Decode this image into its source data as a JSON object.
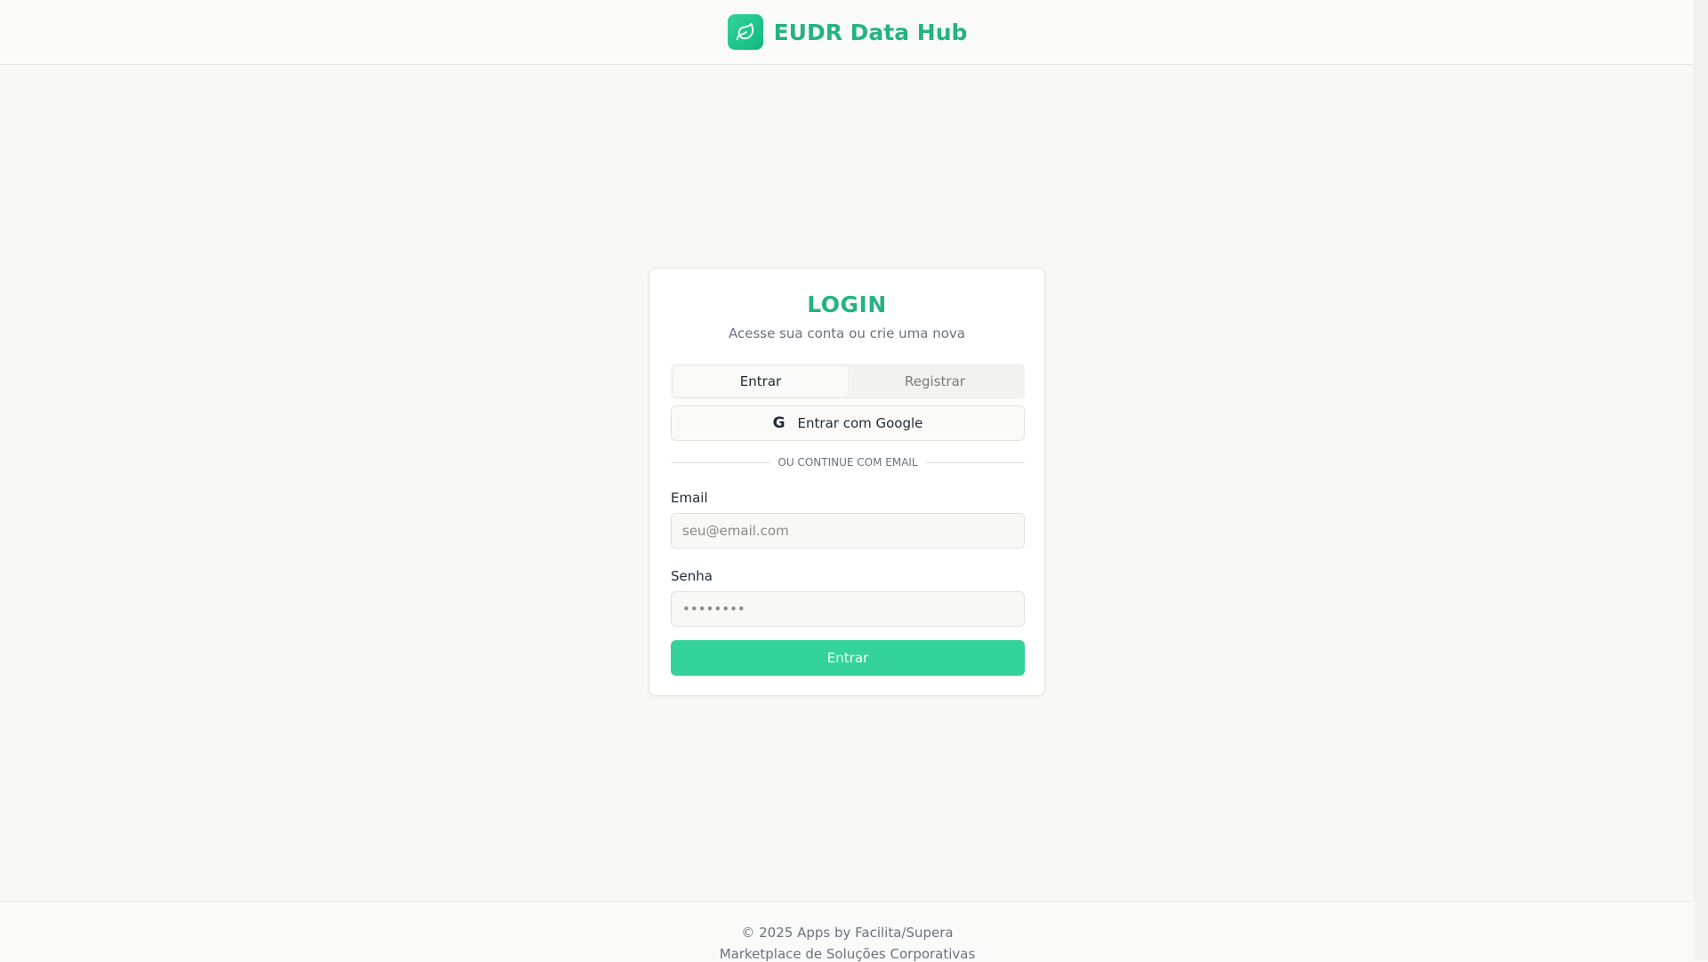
{
  "header": {
    "brand_name": "EUDR Data Hub",
    "logo_icon": "leaf-icon",
    "accent_color": "#24b382"
  },
  "login": {
    "title": "LOGIN",
    "subtitle": "Acesse sua conta ou crie uma nova",
    "tabs": [
      {
        "label": "Entrar",
        "active": true
      },
      {
        "label": "Registrar",
        "active": false
      }
    ],
    "google_button": {
      "label": "Entrar com Google",
      "icon": "google-icon"
    },
    "divider_text": "OU CONTINUE COM EMAIL",
    "email": {
      "label": "Email",
      "placeholder": "seu@email.com",
      "value": ""
    },
    "password": {
      "label": "Senha",
      "placeholder": "••••••••",
      "value": ""
    },
    "submit_label": "Entrar",
    "submit_color": "#34d399"
  },
  "footer": {
    "copyright": "© 2025 Apps by Facilita/Supera",
    "tagline": "Marketplace de Soluções Corporativas"
  }
}
